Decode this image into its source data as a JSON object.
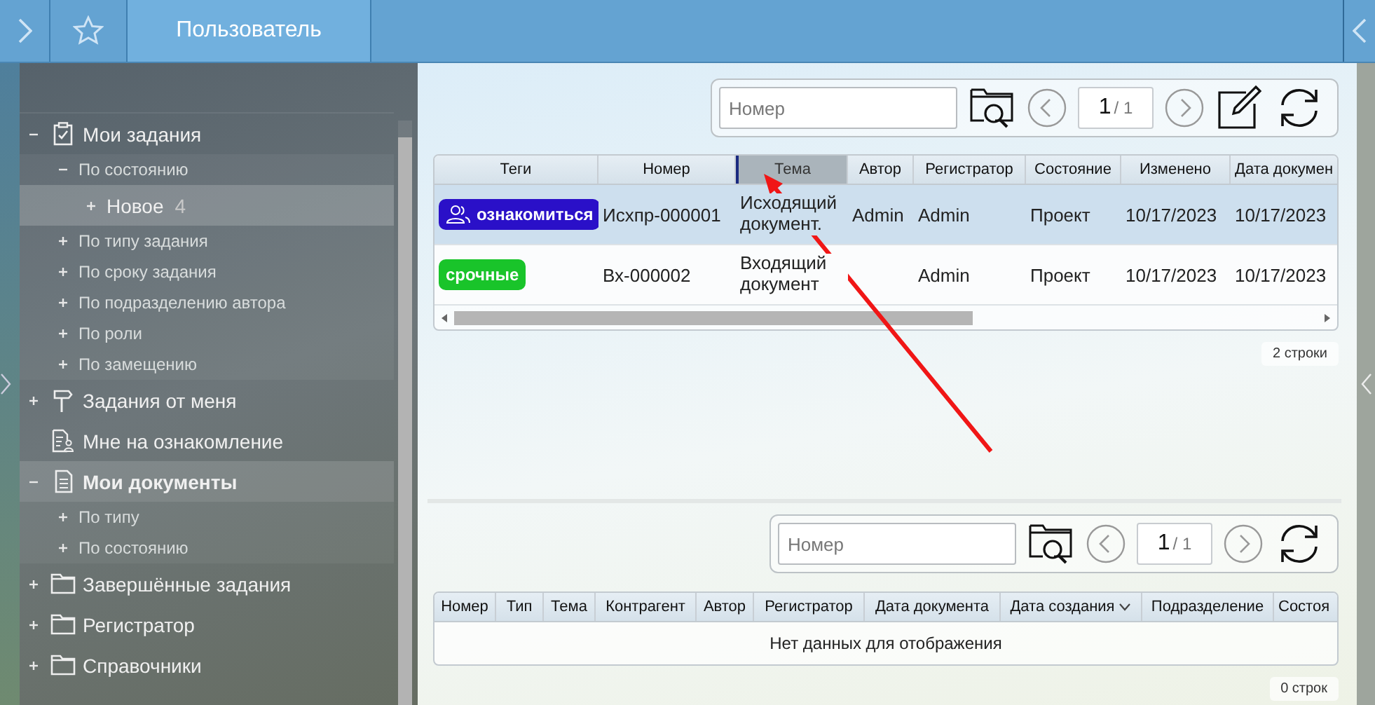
{
  "header": {
    "title": "Пользователь"
  },
  "sidebar": {
    "items": [
      {
        "label": "Мои задания",
        "kind": "clipboard",
        "expanded": true,
        "selected": false,
        "children": [
          {
            "label": "По состоянию",
            "expanded": true,
            "selected": false,
            "children": [
              {
                "label": "Новое",
                "count": "4",
                "expanded": false,
                "selected": true
              }
            ]
          },
          {
            "label": "По типу задания",
            "expanded": false,
            "selected": false
          },
          {
            "label": "По сроку задания",
            "expanded": false,
            "selected": false
          },
          {
            "label": "По подразделению автора",
            "expanded": false,
            "selected": false
          },
          {
            "label": "По роли",
            "expanded": false,
            "selected": false
          },
          {
            "label": "По замещению",
            "expanded": false,
            "selected": false
          }
        ]
      },
      {
        "label": "Задания от меня",
        "kind": "signpost",
        "expanded": false,
        "selected": false
      },
      {
        "label": "Мне на ознакомление",
        "kind": "review",
        "selected": false
      },
      {
        "label": "Мои документы",
        "kind": "document",
        "expanded": true,
        "selected": true,
        "children": [
          {
            "label": "По типу",
            "expanded": false,
            "selected": false
          },
          {
            "label": "По состоянию",
            "expanded": false,
            "selected": false
          }
        ]
      },
      {
        "label": "Завершённые задания",
        "kind": "folder",
        "expanded": false,
        "selected": false
      },
      {
        "label": "Регистратор",
        "kind": "folder",
        "expanded": false,
        "selected": false
      },
      {
        "label": "Справочники",
        "kind": "folder",
        "expanded": false,
        "selected": false
      }
    ]
  },
  "top_pane": {
    "toolbar": {
      "search": {
        "placeholder": "Номер"
      },
      "page": "1",
      "pages": "/ 1",
      "edit": true
    },
    "table": {
      "columns": [
        {
          "label": "Теги",
          "dragging": false
        },
        {
          "label": "Номер",
          "dragging": false
        },
        {
          "label": "Тема",
          "dragging": true
        },
        {
          "label": "Автор",
          "dragging": false
        },
        {
          "label": "Регистратор",
          "dragging": false
        },
        {
          "label": "Состояние",
          "dragging": false
        },
        {
          "label": "Изменено",
          "dragging": false
        },
        {
          "label": "Дата докумен",
          "dragging": false
        }
      ],
      "rows": [
        {
          "selected": true,
          "cells": [
            {
              "tag": {
                "label": "ознакомиться",
                "kind": "group",
                "color": "#2a10c8"
              }
            },
            {
              "text": "Исхпр-000001"
            },
            {
              "text": "Исходящий документ."
            },
            {
              "text": "Admin"
            },
            {
              "text": "Admin"
            },
            {
              "text": "Проект"
            },
            {
              "text": "10/17/2023"
            },
            {
              "text": "10/17/2023"
            }
          ]
        },
        {
          "selected": false,
          "cells": [
            {
              "tag": {
                "label": "срочные",
                "kind": "plain",
                "color": "#19c42a"
              }
            },
            {
              "text": "Вх-000002"
            },
            {
              "text": "Входящий документ"
            },
            {},
            {
              "text": "Admin"
            },
            {
              "text": "Проект"
            },
            {
              "text": "10/17/2023"
            },
            {
              "text": "10/17/2023"
            }
          ]
        }
      ]
    },
    "row_count": "2 строки"
  },
  "bottom_pane": {
    "toolbar": {
      "search": {
        "placeholder": "Номер"
      },
      "page": "1",
      "pages": "/ 1",
      "edit": false
    },
    "table": {
      "columns": [
        {
          "label": "Номер"
        },
        {
          "label": "Тип"
        },
        {
          "label": "Тема"
        },
        {
          "label": "Контрагент"
        },
        {
          "label": "Автор"
        },
        {
          "label": "Регистратор"
        },
        {
          "label": "Дата документа"
        },
        {
          "label": "Дата создания",
          "sorted": true
        },
        {
          "label": "Подразделение"
        },
        {
          "label": "Состоя"
        }
      ],
      "empty_message": "Нет данных для отображения"
    },
    "row_count": "0 строк"
  }
}
